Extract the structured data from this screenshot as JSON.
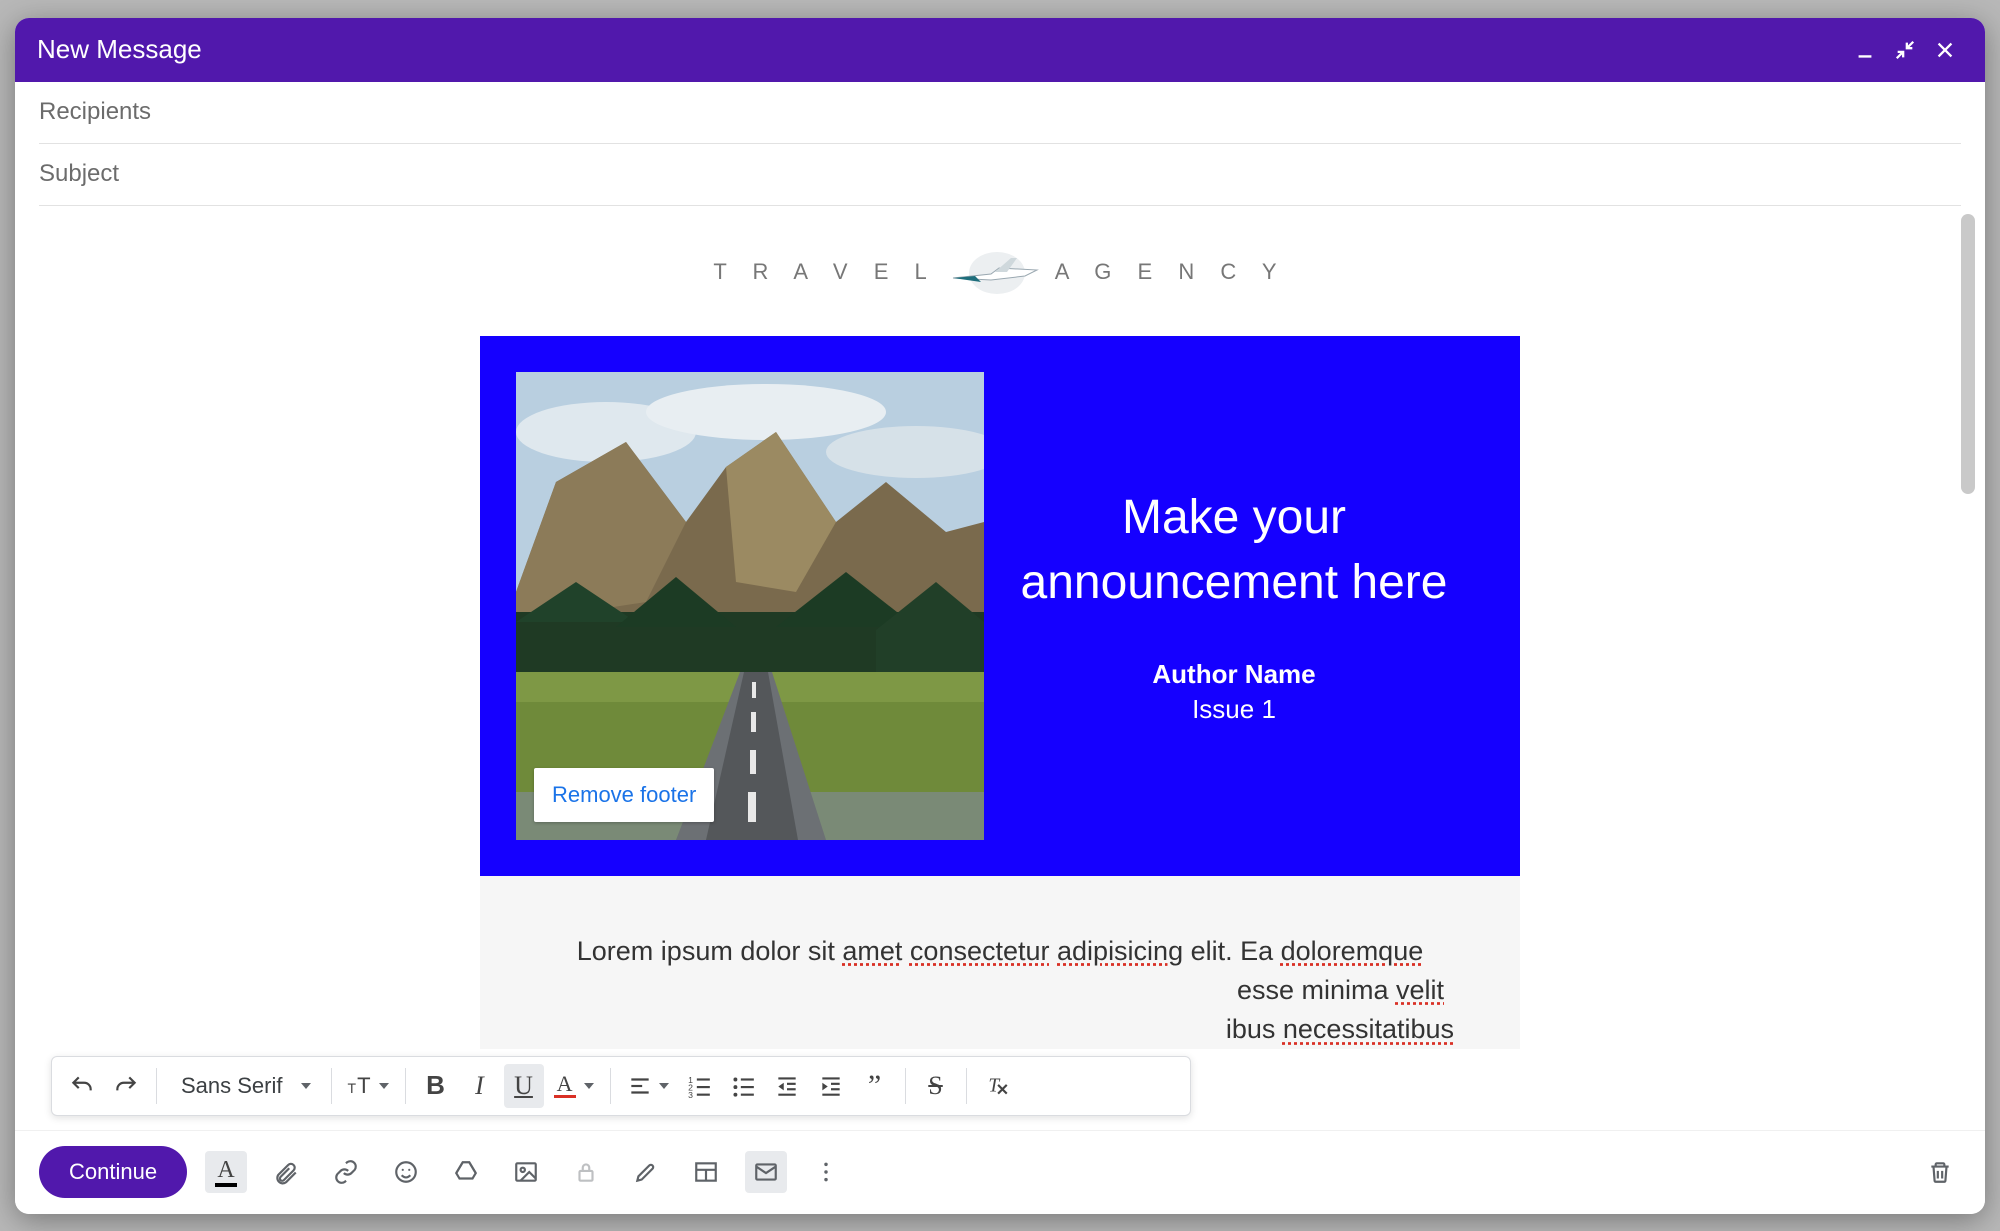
{
  "window": {
    "title": "New Message"
  },
  "fields": {
    "recipients_placeholder": "Recipients",
    "subject_placeholder": "Subject"
  },
  "template": {
    "logo_left": "T R A V E L",
    "logo_right": "A G E N C Y",
    "hero": {
      "headline": "Make your announcement here",
      "author": "Author Name",
      "issue": "Issue 1",
      "remove_footer_label": "Remove footer",
      "bg_color": "#1500ff"
    },
    "body_text_plain": "Lorem ipsum dolor sit ",
    "body_spell_1": "amet",
    "body_text_2": " ",
    "body_spell_2": "consectetur",
    "body_text_3": " ",
    "body_spell_3": "adipisicing",
    "body_text_4": " elit. Ea ",
    "body_spell_4": "doloremque",
    "body_line2_a": "esse minima ",
    "body_line2_spell": "velit",
    "body_line3_a": "ibus ",
    "body_line3_spell": "necessitatibus"
  },
  "format_toolbar": {
    "font_family": "Sans Serif"
  },
  "actions": {
    "continue_label": "Continue"
  }
}
